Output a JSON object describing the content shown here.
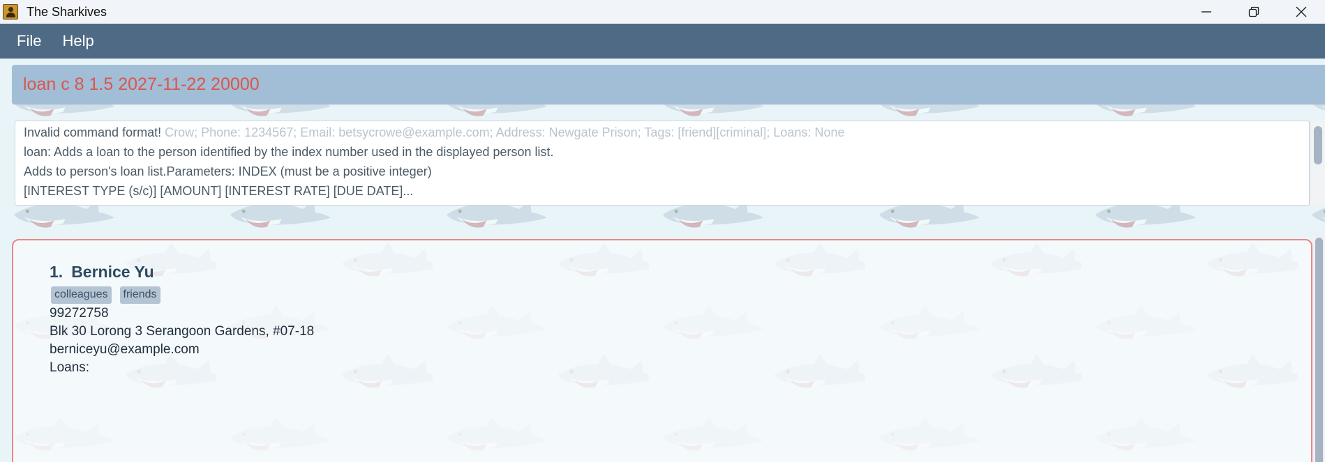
{
  "window": {
    "title": "The Sharkives"
  },
  "menu": {
    "items": [
      "File",
      "Help"
    ]
  },
  "command_box": {
    "value": "loan c 8 1.5 2027-11-22 20000"
  },
  "result_box": {
    "line1_main": "Invalid command format!",
    "line1_ghost": " Crow; Phone: 1234567; Email: betsycrowe@example.com; Address: Newgate Prison; Tags: [friend][criminal]; Loans: None",
    "line2": "loan: Adds a loan to the person identified by the index number used in the displayed person list.",
    "line3": "Adds to person's loan list.Parameters: INDEX (must be a positive integer)",
    "line4": "[INTEREST TYPE (s/c)] [AMOUNT] [INTEREST RATE] [DUE DATE]..."
  },
  "person_list": {
    "persons": [
      {
        "index": "1.",
        "name": "Bernice Yu",
        "tags": [
          "colleagues",
          "friends"
        ],
        "phone": "99272758",
        "address": "Blk 30 Lorong 3 Serangoon Gardens, #07-18",
        "email": "berniceyu@example.com",
        "loans_label": "Loans:"
      }
    ]
  },
  "colors": {
    "menubar": "#4e6a84",
    "command_box": "#a2bdd6",
    "command_text": "#d8574c",
    "card_border": "#f08585",
    "tag_bg": "#b4c4d3"
  },
  "icons": {
    "app": "sharkives-app-icon",
    "minimize": "minimize-icon",
    "restore": "restore-icon",
    "close": "close-icon"
  }
}
